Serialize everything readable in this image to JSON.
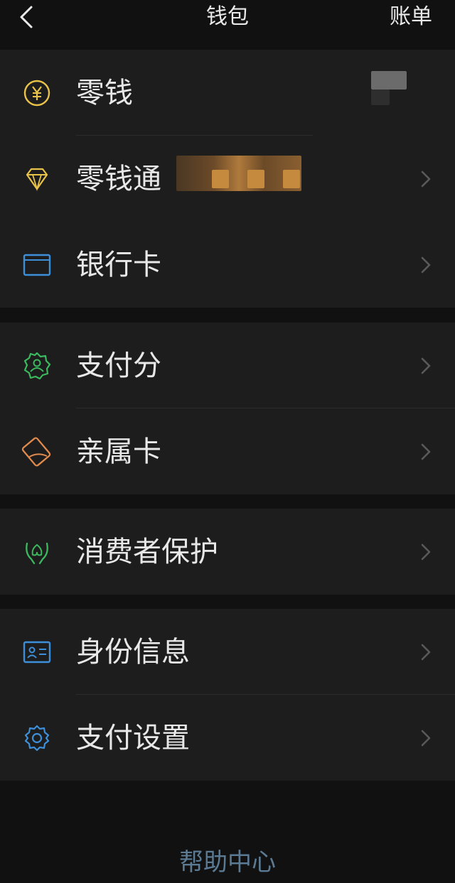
{
  "nav": {
    "back_icon": "chevron-left-icon",
    "title": "钱包",
    "bill_label": "账单"
  },
  "groups": [
    {
      "items": [
        {
          "id": "change",
          "label": "零钱",
          "icon": "yuan-coin-icon",
          "icon_color": "#e9c24a",
          "has_chevron": false
        },
        {
          "id": "licaitong",
          "label": "零钱通",
          "icon": "diamond-icon",
          "icon_color": "#e9c24a",
          "has_chevron": true
        },
        {
          "id": "bank-card",
          "label": "银行卡",
          "icon": "bank-card-icon",
          "icon_color": "#3d8fd9",
          "has_chevron": true
        }
      ]
    },
    {
      "items": [
        {
          "id": "pay-score",
          "label": "支付分",
          "icon": "pay-score-badge-icon",
          "icon_color": "#3cb95f",
          "has_chevron": true
        },
        {
          "id": "family-card",
          "label": "亲属卡",
          "icon": "family-card-icon",
          "icon_color": "#e08a4e",
          "has_chevron": true
        }
      ]
    },
    {
      "items": [
        {
          "id": "consumer-protection",
          "label": "消费者保护",
          "icon": "protect-hands-icon",
          "icon_color": "#3cb95f",
          "has_chevron": true
        }
      ]
    },
    {
      "items": [
        {
          "id": "identity-info",
          "label": "身份信息",
          "icon": "id-card-icon",
          "icon_color": "#3d8fd9",
          "has_chevron": true
        },
        {
          "id": "pay-settings",
          "label": "支付设置",
          "icon": "gear-icon",
          "icon_color": "#3d8fd9",
          "has_chevron": true
        }
      ]
    }
  ],
  "footer": {
    "help_label": "帮助中心"
  },
  "colors": {
    "background": "#111111",
    "card": "#1d1d1d",
    "text": "#e8e8e8",
    "link": "#5b7a93",
    "chevron": "#5a5a5a"
  }
}
